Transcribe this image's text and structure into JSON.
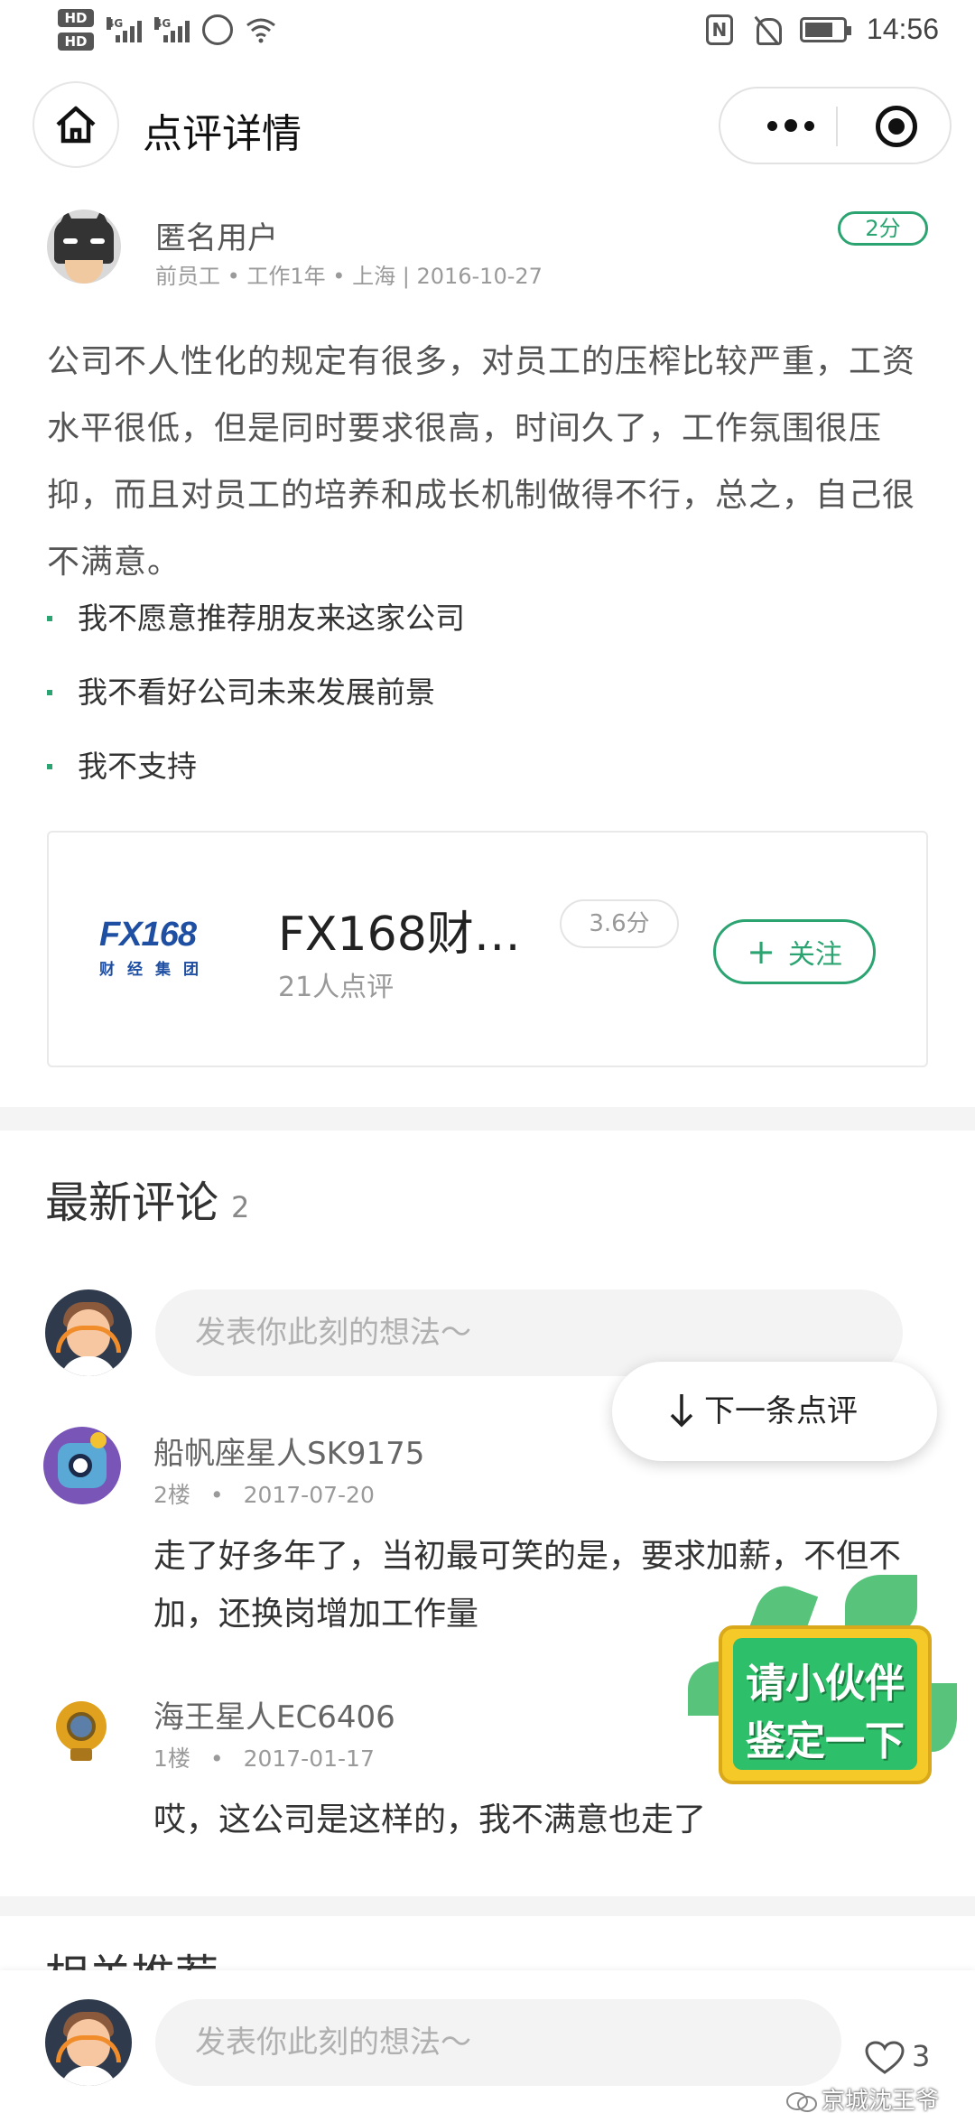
{
  "status_bar": {
    "time": "14:56",
    "hd1": "HD",
    "hd2": "HD",
    "net1": "4G",
    "net2": "4G",
    "nfc": "N"
  },
  "nav": {
    "title": "点评详情"
  },
  "review": {
    "author": "匿名用户",
    "meta": "前员工 • 工作1年 • 上海 | 2016-10-27",
    "score": "2分",
    "body": "公司不人性化的规定有很多，对员工的压榨比较严重，工资水平很低，但是同时要求很高，时间久了，工作氛围很压抑，而且对员工的培养和成长机制做得不行，总之，自己很不满意。",
    "points": [
      "我不愿意推荐朋友来这家公司",
      "我不看好公司未来发展前景",
      "我不支持"
    ]
  },
  "company": {
    "logo_text": "FX168",
    "logo_sub": "财经集团",
    "name": "FX168财…",
    "score": "3.6分",
    "reviews": "21人点评",
    "follow_label": "关注"
  },
  "comments": {
    "title": "最新评论",
    "count": "2",
    "input_placeholder": "发表你此刻的想法～",
    "next_review_label": "下一条点评",
    "items": [
      {
        "name": "船帆座星人SK9175",
        "floor": "2楼",
        "date": "2017-07-20",
        "text": "走了好多年了，当初最可笑的是，要求加薪，不但不加，还换岗增加工作量"
      },
      {
        "name": "海王星人EC6406",
        "floor": "1楼",
        "date": "2017-01-17",
        "text": "哎，这公司是这样的，我不满意也走了"
      }
    ]
  },
  "sticker": {
    "line1": "请小伙伴",
    "line2": "鉴定一下"
  },
  "related": {
    "title": "相关推荐"
  },
  "bottom": {
    "input_placeholder": "发表你此刻的想法～",
    "like_count": "3",
    "watermark": "京城沈王爷"
  },
  "colors": {
    "accent": "#2ba471",
    "text_muted": "#9a9a9a",
    "background": "#ffffff",
    "band": "#f4f4f4"
  }
}
